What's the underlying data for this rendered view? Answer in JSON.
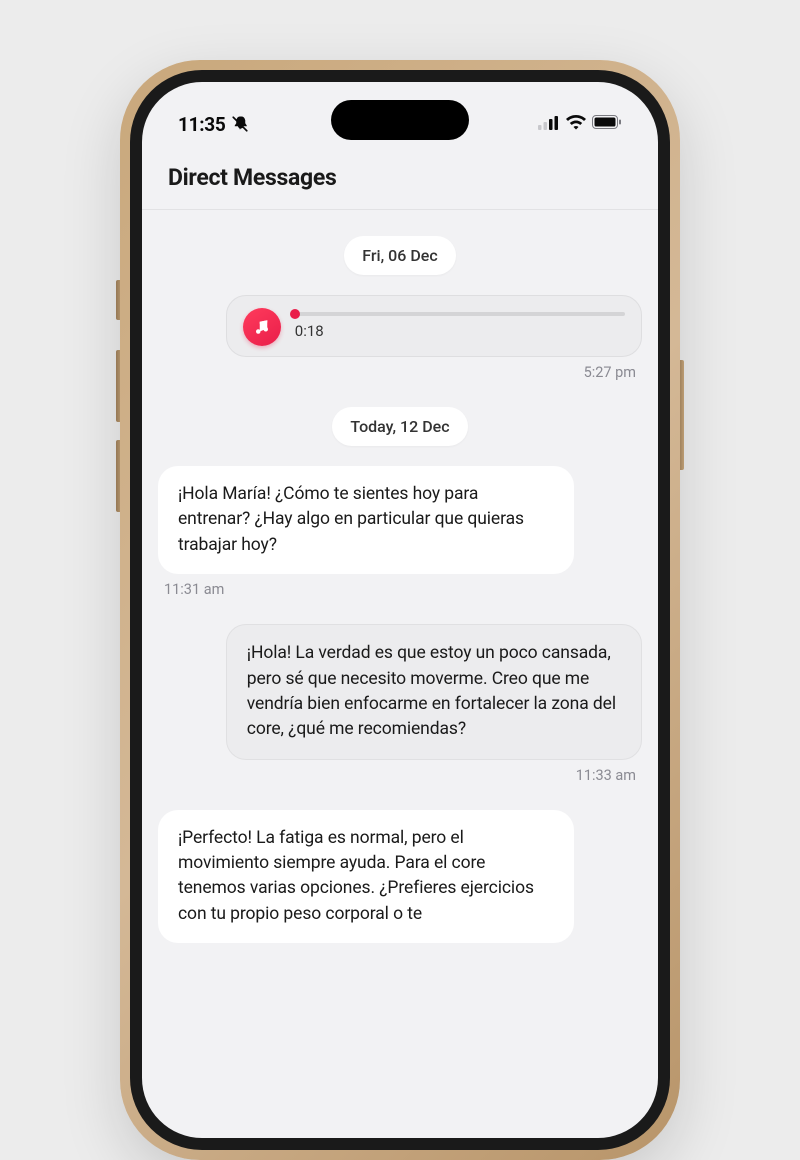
{
  "status_bar": {
    "time": "11:35"
  },
  "header": {
    "title": "Direct Messages"
  },
  "chat": {
    "separators": {
      "first": "Fri, 06 Dec",
      "second": "Today, 12 Dec"
    },
    "audio": {
      "duration": "0:18",
      "timestamp": "5:27 pm"
    },
    "messages": [
      {
        "side": "left",
        "style": "incoming",
        "text": "¡Hola María! ¿Cómo te sientes hoy para entrenar? ¿Hay algo en particular que quieras trabajar hoy?",
        "timestamp": "11:31 am"
      },
      {
        "side": "right",
        "style": "outgoing",
        "text": "¡Hola! La verdad es que estoy un poco cansada, pero sé que necesito moverme. Creo que me vendría bien enfocarme en fortalecer la zona del core, ¿qué me recomiendas?",
        "timestamp": "11:33 am"
      },
      {
        "side": "left",
        "style": "incoming",
        "text": "¡Perfecto! La fatiga es normal, pero el movimiento siempre ayuda. Para el core tenemos varias opciones. ¿Prefieres ejercicios con tu propio peso corporal o te",
        "timestamp": ""
      }
    ]
  }
}
